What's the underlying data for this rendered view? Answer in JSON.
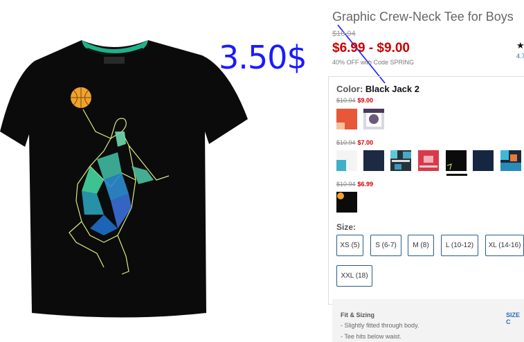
{
  "product": {
    "title": "Graphic Crew-Neck Tee for Boys",
    "original_price": "$10.94",
    "price_range": "$6.99 - $9.00",
    "promo_text": "40% OFF with Code SPRING",
    "rating_star": "★",
    "rating_value": "4.7"
  },
  "annotation": {
    "text": "3.50$",
    "color": "#1a1aff"
  },
  "color_selector": {
    "label": "Color:",
    "selected": "Black Jack 2",
    "groups": [
      {
        "old_price": "$10.94",
        "new_price": "$9.00"
      },
      {
        "old_price": "$10.94",
        "new_price": "$7.00"
      },
      {
        "old_price": "$10.94",
        "new_price": "$6.99"
      }
    ]
  },
  "size_selector": {
    "label": "Size:",
    "sizes": [
      "XS (5)",
      "S (6-7)",
      "M (8)",
      "L (10-12)",
      "XL (14-16)",
      "XXL (18)"
    ]
  },
  "fit": {
    "title": "Fit & Sizing",
    "link": "SIZE C",
    "lines": [
      "- Slightly fitted through body.",
      "- Tee hits below waist."
    ]
  },
  "colors": {
    "price_red": "#cc0000",
    "link_blue": "#2a6cb0",
    "size_border": "#2a5a8a"
  }
}
